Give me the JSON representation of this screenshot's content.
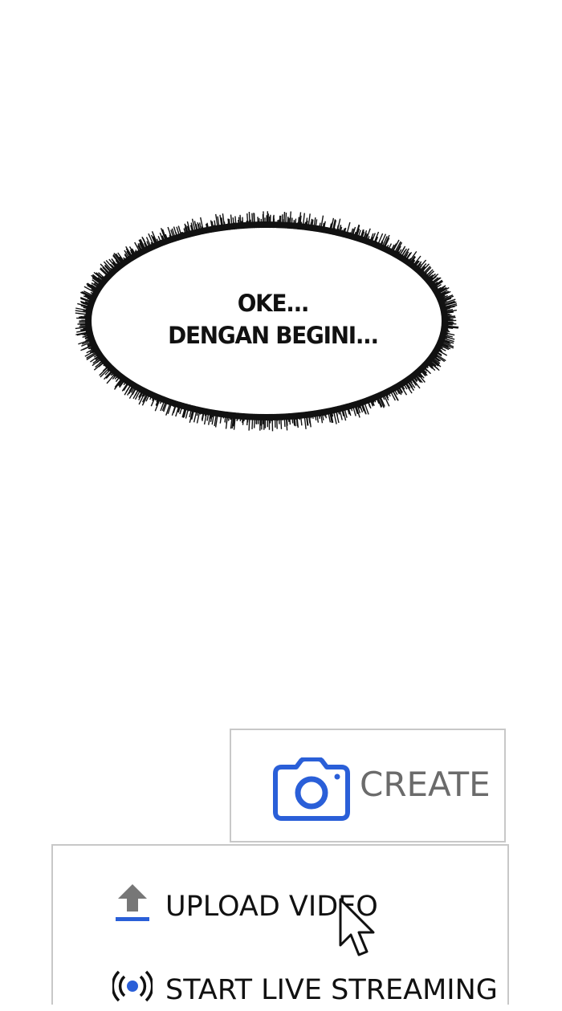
{
  "speech_bubble": {
    "line1": "OKE...",
    "line2": "DENGAN BEGINI..."
  },
  "create_button": {
    "label": "CREATE",
    "icon": "camera-icon",
    "icon_color": "#2a5fd8",
    "label_color": "#6b6b6b"
  },
  "create_menu": {
    "items": [
      {
        "label": "UPLOAD VIDEO",
        "icon": "upload-icon"
      },
      {
        "label": "START LIVE STREAMING",
        "icon": "live-stream-icon"
      }
    ]
  },
  "colors": {
    "accent": "#2a5fd8",
    "border": "#c8c8c8",
    "text": "#111111"
  }
}
